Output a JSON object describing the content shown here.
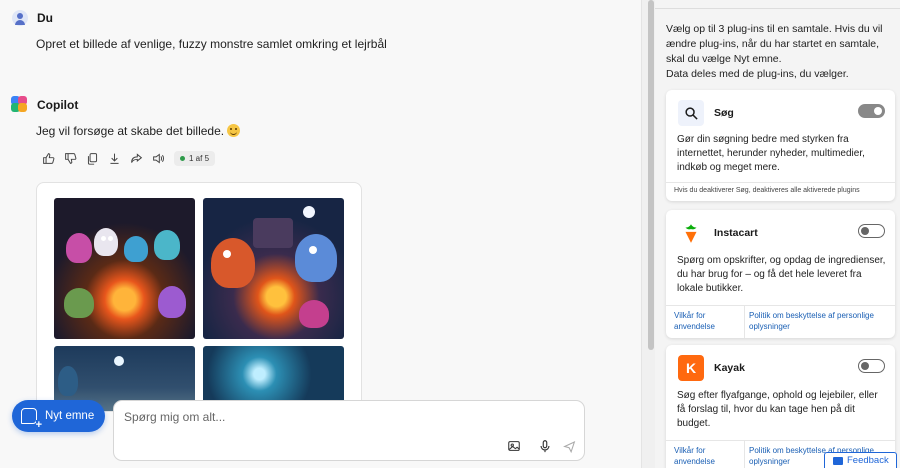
{
  "chat": {
    "user": {
      "name": "Du",
      "message": "Opret et billede af venlige, fuzzy monstre samlet omkring et lejrbål"
    },
    "copilot": {
      "name": "Copilot",
      "message": "Jeg vil forsøge at skabe det billede.",
      "emoji_icon": "smile-emoji-icon",
      "pager": "1 af 5",
      "actions": [
        "thumbs-up-icon",
        "thumbs-down-icon",
        "copy-icon",
        "download-icon",
        "share-icon",
        "speaker-icon"
      ]
    }
  },
  "composer": {
    "new_topic_label": "Nyt emne",
    "placeholder": "Spørg mig om alt...",
    "icons": [
      "image-upload-icon",
      "microphone-icon",
      "send-icon"
    ]
  },
  "panel": {
    "intro": "Vælg op til 3 plug-ins til en samtale. Hvis du vil ændre plug-ins, når du har startet en samtale, skal du vælge Nyt emne.",
    "shared": "Data deles med de plug-ins, du vælger.",
    "plugins": [
      {
        "name": "Søg",
        "enabled": true,
        "description": "Gør din søgning bedre med styrken fra internettet, herunder nyheder, multimedier, indkøb og meget mere.",
        "note": "Hvis du deaktiverer Søg, deaktiveres alle aktiverede plugins"
      },
      {
        "name": "Instacart",
        "enabled": false,
        "description": "Spørg om opskrifter, og opdag de ingredienser, du har brug for – og få det hele leveret fra lokale butikker.",
        "terms": "Vilkår for anvendelse",
        "privacy": "Politik om beskyttelse af personlige oplysninger"
      },
      {
        "name": "Kayak",
        "enabled": false,
        "description": "Søg efter flyafgange, ophold og lejebiler, eller få forslag til, hvor du kan tage hen på dit budget.",
        "terms": "Vilkår for anvendelse",
        "privacy": "Politik om beskyttelse af personlige oplysninger"
      }
    ]
  },
  "feedback_label": "Feedback",
  "colors": {
    "accent": "#1f66d8",
    "link": "#1a5fb4",
    "kayak": "#ff690f",
    "instacart": "#0aad0a"
  }
}
